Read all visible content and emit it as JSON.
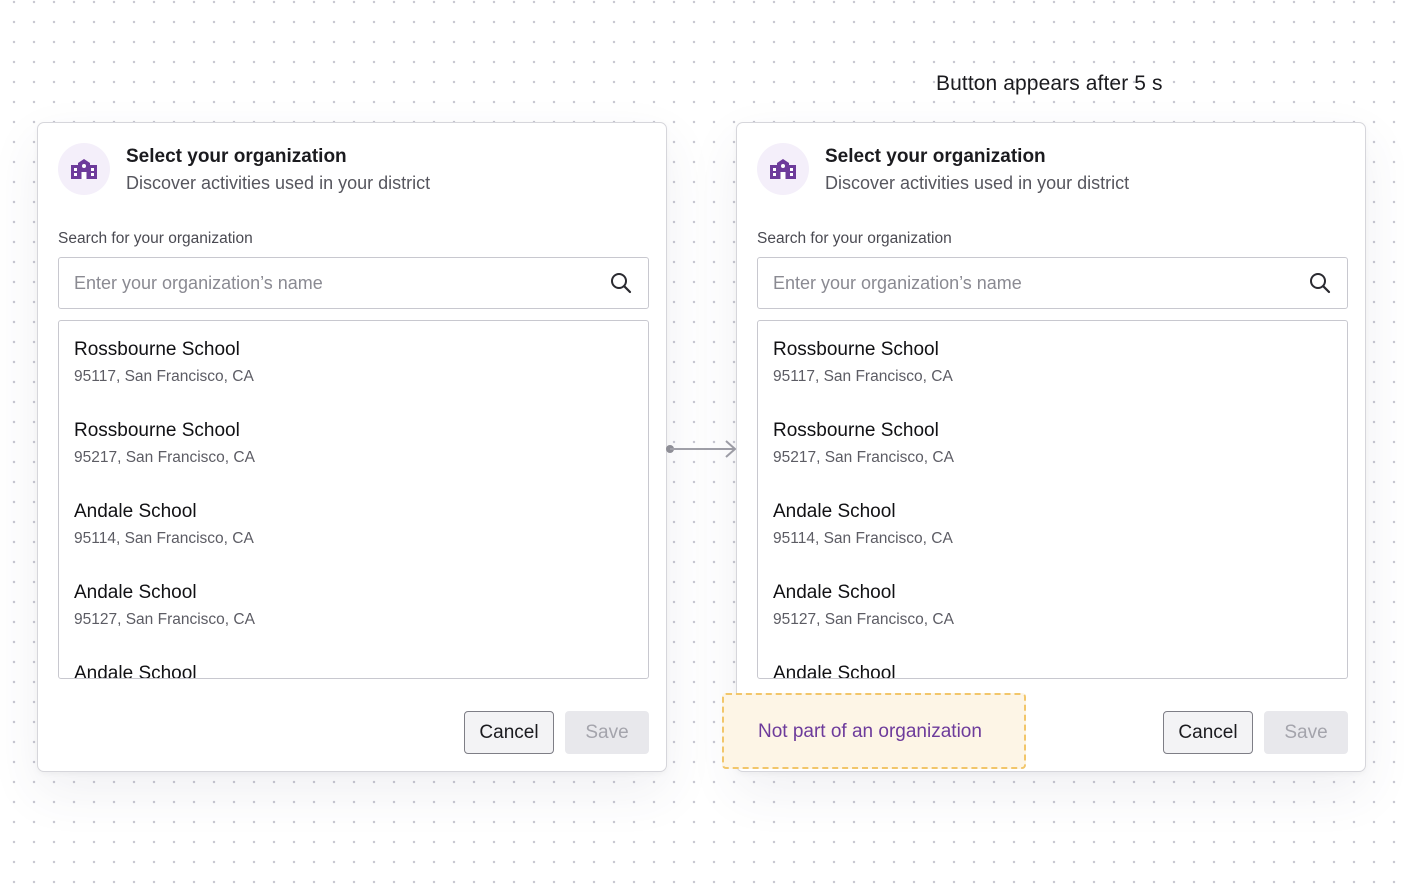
{
  "annotation": "Button appears after 5 s",
  "dialogs": [
    {
      "title": "Select your organization",
      "subtitle": "Discover activities used in your district",
      "search_label": "Search for your organization",
      "search_placeholder": "Enter your organization’s name",
      "search_value": "",
      "results": [
        {
          "name": "Rossbourne School",
          "address": "95117, San Francisco, CA"
        },
        {
          "name": "Rossbourne School",
          "address": "95217, San Francisco, CA"
        },
        {
          "name": "Andale School",
          "address": "95114, San Francisco, CA"
        },
        {
          "name": "Andale School",
          "address": "95127, San Francisco, CA"
        },
        {
          "name": "Andale School",
          "address": ""
        }
      ],
      "cancel_label": "Cancel",
      "save_label": "Save"
    },
    {
      "title": "Select your organization",
      "subtitle": "Discover activities used in your district",
      "search_label": "Search for your organization",
      "search_placeholder": "Enter your organization’s name",
      "search_value": "",
      "results": [
        {
          "name": "Rossbourne School",
          "address": "95117, San Francisco, CA"
        },
        {
          "name": "Rossbourne School",
          "address": "95217, San Francisco, CA"
        },
        {
          "name": "Andale School",
          "address": "95114, San Francisco, CA"
        },
        {
          "name": "Andale School",
          "address": "95127, San Francisco, CA"
        },
        {
          "name": "Andale School",
          "address": ""
        }
      ],
      "cancel_label": "Cancel",
      "save_label": "Save",
      "not_part_label": "Not part of an organization"
    }
  ],
  "icons": {
    "header": "school-building-icon",
    "search": "search-icon",
    "flow": "arrow-right-icon"
  },
  "colors": {
    "accent_purple": "#6d3b9b",
    "icon_bg": "#f4effa",
    "highlight_bg": "#fdf5e6",
    "highlight_border": "#f2c66a"
  }
}
